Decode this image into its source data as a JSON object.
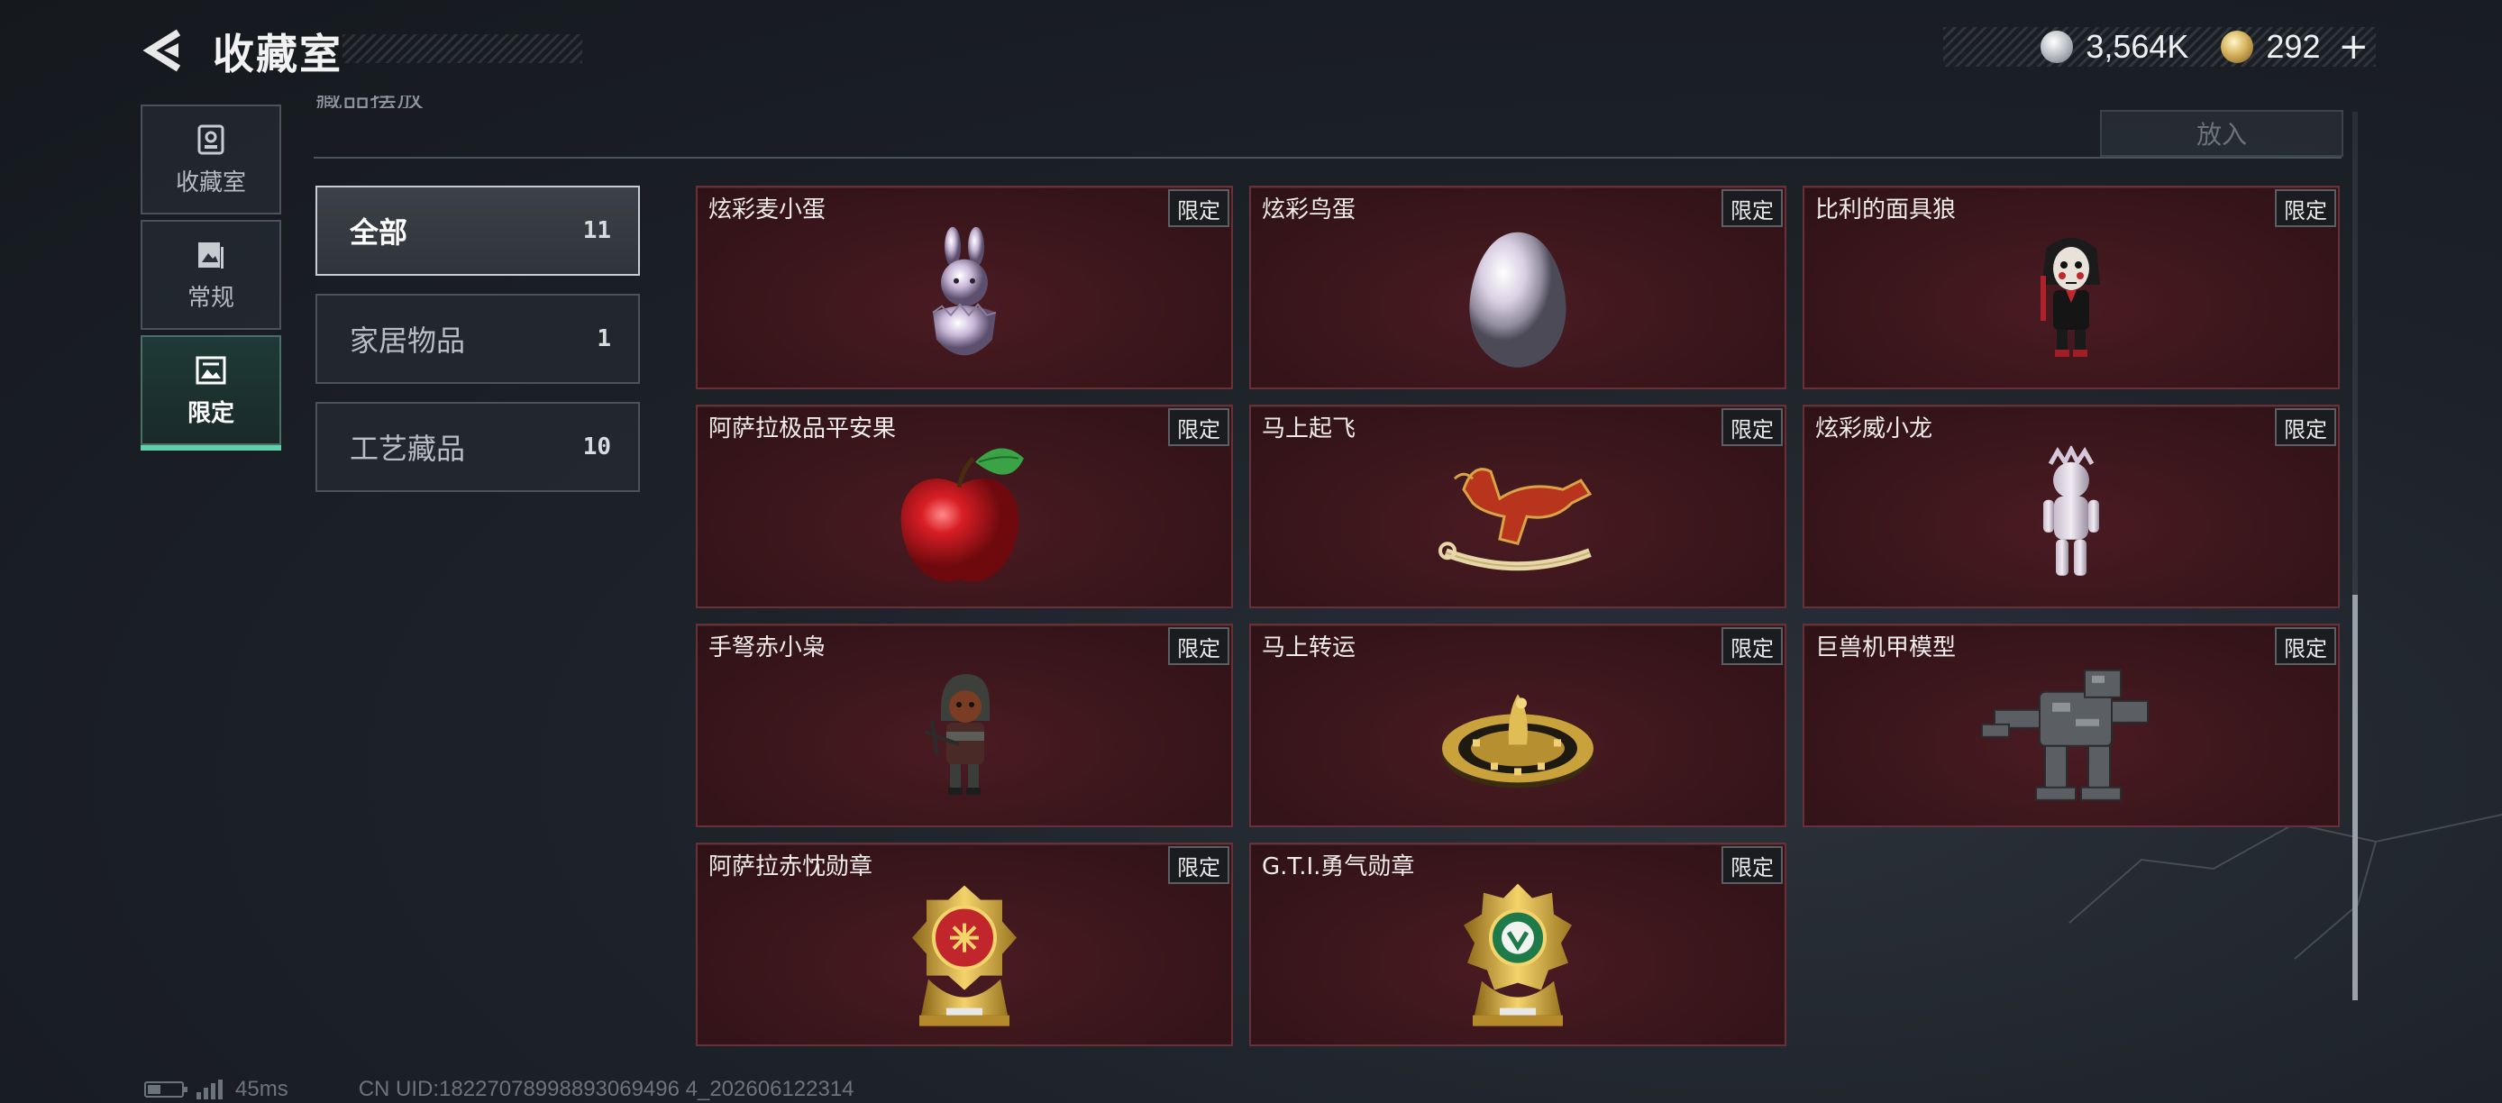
{
  "header": {
    "title": "收藏室",
    "currency": [
      {
        "icon": "silver-coin-icon",
        "value": "3,564K"
      },
      {
        "icon": "gold-coin-icon",
        "value": "292"
      }
    ],
    "add_label": "+"
  },
  "sidenav": [
    {
      "label": "收藏室",
      "icon": "display-case-icon",
      "active": false
    },
    {
      "label": "常规",
      "icon": "picture-frame-icon",
      "active": false
    },
    {
      "label": "限定",
      "icon": "limited-picture-icon",
      "active": true
    }
  ],
  "put_button_label": "放入",
  "categories": [
    {
      "name": "全部",
      "count": "11",
      "active": true
    },
    {
      "name": "家居物品",
      "count": "1",
      "active": false
    },
    {
      "name": "工艺藏品",
      "count": "10",
      "active": false
    }
  ],
  "items": [
    {
      "name": "炫彩麦小蛋",
      "tag": "限定",
      "art": "rabbit-egg"
    },
    {
      "name": "炫彩鸟蛋",
      "tag": "限定",
      "art": "egg"
    },
    {
      "name": "比利的面具狼",
      "tag": "限定",
      "art": "puppet"
    },
    {
      "name": "阿萨拉极品平安果",
      "tag": "限定",
      "art": "apple"
    },
    {
      "name": "马上起飞",
      "tag": "限定",
      "art": "horse"
    },
    {
      "name": "炫彩威小龙",
      "tag": "限定",
      "art": "figurine"
    },
    {
      "name": "手弩赤小枭",
      "tag": "限定",
      "art": "hooded-figure"
    },
    {
      "name": "马上转运",
      "tag": "限定",
      "art": "gold-disc"
    },
    {
      "name": "巨兽机甲模型",
      "tag": "限定",
      "art": "mech"
    },
    {
      "name": "阿萨拉赤忱勋章",
      "tag": "限定",
      "art": "medal-red"
    },
    {
      "name": "G.T.I.勇气勋章",
      "tag": "限定",
      "art": "medal-green"
    }
  ],
  "footer": {
    "ping": "45ms",
    "uid": "CN UID:18227078998893069496 4_202606122314"
  },
  "colors": {
    "accent": "#5fd0a8",
    "card_bg": "#3a161b",
    "card_border": "#6a3038"
  }
}
